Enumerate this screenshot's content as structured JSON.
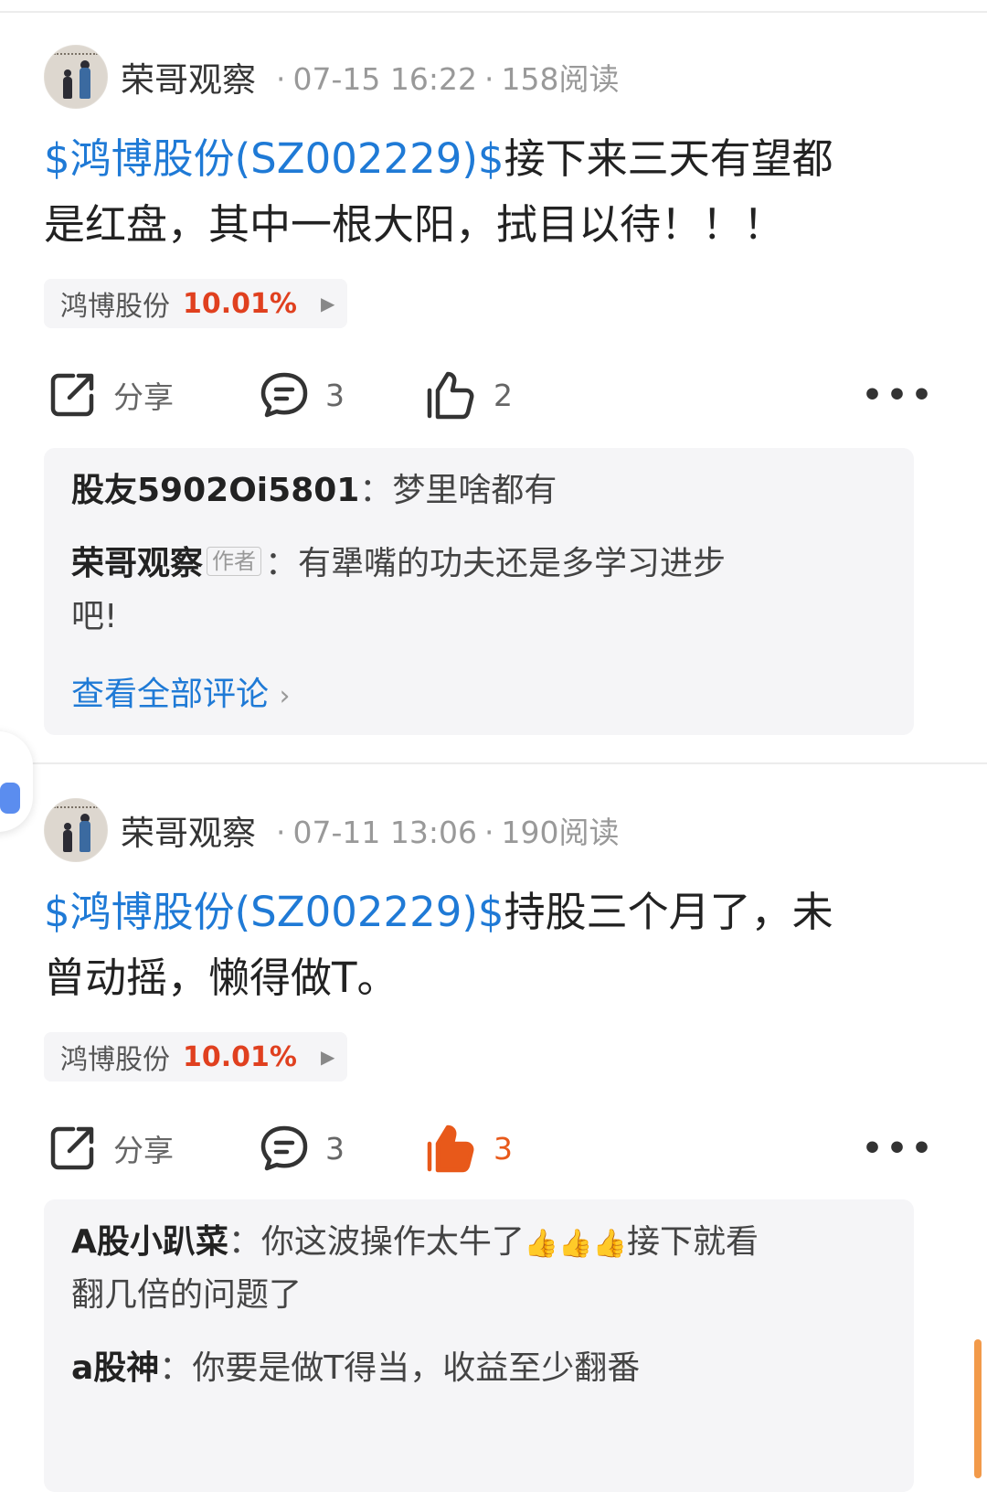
{
  "posts": [
    {
      "author": "荣哥观察",
      "time": "07-15 16:22",
      "reads": "158阅读",
      "stock_tag": "$鸿博股份(SZ002229)$",
      "text_line1": "接下来三天有望都",
      "text_line2": "是红盘，其中一根大阳，拭目以待！！！",
      "chip_name": "鸿博股份",
      "chip_pct": "10.01%",
      "share_label": "分享",
      "comment_count": "3",
      "like_count": "2",
      "liked": false,
      "comments": [
        {
          "user": "股友5902Oi5801",
          "sep": "：",
          "text": "梦里啥都有"
        },
        {
          "user": "荣哥观察",
          "badge": "作者",
          "sep": "：",
          "text": "有犟嘴的功夫还是多学习进步",
          "text2": "吧!"
        }
      ],
      "view_all": "查看全部评论"
    },
    {
      "author": "荣哥观察",
      "time": "07-11 13:06",
      "reads": "190阅读",
      "stock_tag": "$鸿博股份(SZ002229)$",
      "text_line1": "持股三个月了，未",
      "text_line2": "曾动摇，懒得做T。",
      "chip_name": "鸿博股份",
      "chip_pct": "10.01%",
      "share_label": "分享",
      "comment_count": "3",
      "like_count": "3",
      "liked": true,
      "comments": [
        {
          "user": "A股小趴菜",
          "sep": "：",
          "text_a": "你这波操作太牛了",
          "emoji": "👍👍👍",
          "text_b": "接下就看",
          "text2": "翻几倍的问题了"
        },
        {
          "user": "a股神",
          "sep": "：",
          "text": "你要是做T得当，收益至少翻番"
        }
      ]
    }
  ],
  "colors": {
    "link_blue": "#1f7ad6",
    "gain_red": "#e0401f",
    "liked_orange": "#e8591a"
  }
}
